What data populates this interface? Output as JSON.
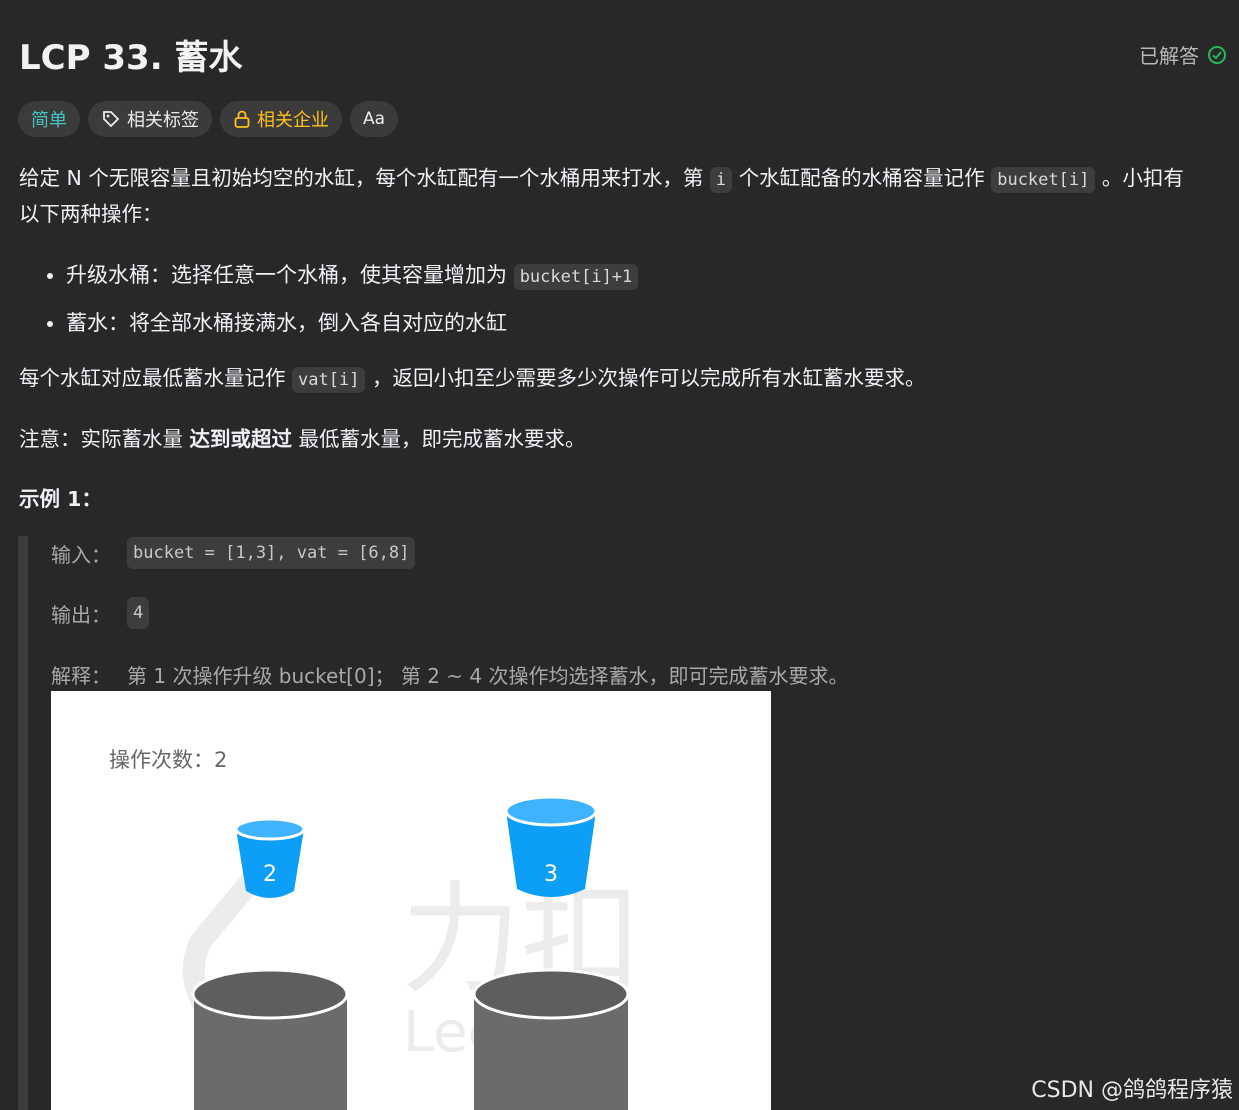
{
  "header": {
    "title": "LCP 33. 蓄水",
    "status": "已解答",
    "status_color": "#2db55d"
  },
  "tags": {
    "difficulty": "简单",
    "related_tags": "相关标签",
    "related_companies": "相关企业",
    "translate": "Aa"
  },
  "description": {
    "p1_a": "给定 N 个无限容量且初始均空的水缸，每个水缸配有一个水桶用来打水，第",
    "p1_code_i": "i",
    "p1_b": "个水缸配备的水桶容量记作",
    "p1_code_bucket": "bucket[i]",
    "p1_c": "。小扣有",
    "p1_line2": "以下两种操作：",
    "op1_text": "升级水桶：选择任意一个水桶，使其容量增加为",
    "op1_code": "bucket[i]+1",
    "op2_text": "蓄水：将全部水桶接满水，倒入各自对应的水缸",
    "p2_a": "每个水缸对应最低蓄水量记作",
    "p2_code": "vat[i]",
    "p2_b": "，返回小扣至少需要多少次操作可以完成所有水缸蓄水要求。",
    "note_a": "注意：实际蓄水量 ",
    "note_bold": "达到或超过",
    "note_b": " 最低蓄水量，即完成蓄水要求。"
  },
  "example": {
    "title": "示例 1：",
    "input_label": "输入：",
    "input_value": "bucket = [1,3], vat = [6,8]",
    "output_label": "输出：",
    "output_value": "4",
    "explain_label": "解释：",
    "explain_value": "第 1 次操作升级 bucket[0]；  第 2 ~ 4 次操作均选择蓄水，即可完成蓄水要求。",
    "illustration": {
      "ops_label": "操作次数：2",
      "bucket1": "2",
      "bucket2": "3",
      "watermark_text": "力扣",
      "watermark_sub": "Lee",
      "bucket_color": "#0d9ef7",
      "vat_color": "#6b6b6b"
    }
  },
  "page_watermark": "CSDN @鸽鸽程序猿"
}
